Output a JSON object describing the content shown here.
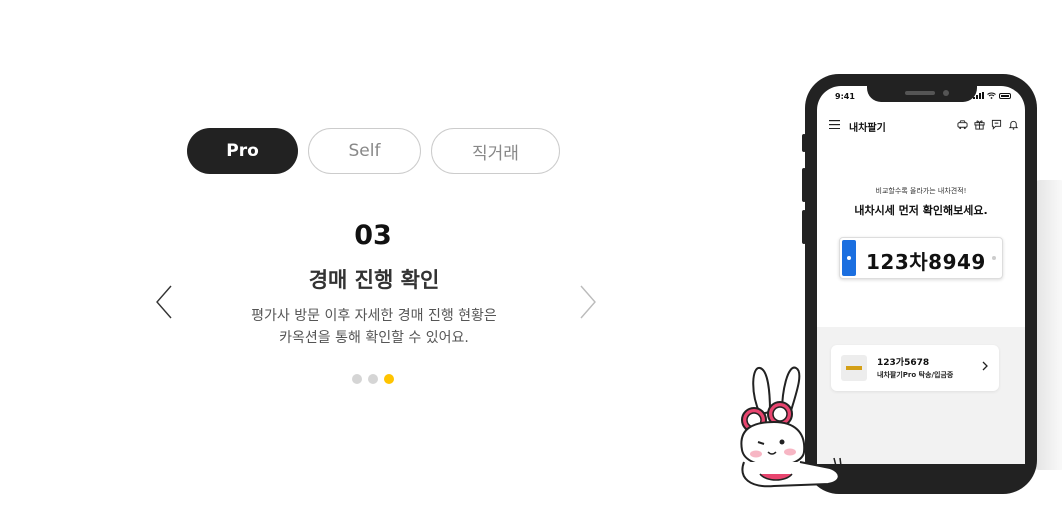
{
  "tabs": [
    {
      "label": "Pro",
      "active": true
    },
    {
      "label": "Self",
      "active": false
    },
    {
      "label": "직거래",
      "active": false
    }
  ],
  "step": {
    "number": "03",
    "title": "경매 진행 확인",
    "desc_line1": "평가사 방문 이후 자세한 경매 진행 현황은",
    "desc_line2": "카옥션을 통해 확인할 수 있어요."
  },
  "carousel": {
    "total": 3,
    "active_index": 2
  },
  "colors": {
    "accent": "#ffc400",
    "dark": "#222222",
    "plate_blue": "#1b6fe0"
  },
  "phone": {
    "status_time": "9:41",
    "app_title": "내차팔기",
    "header_icons": [
      "car-icon",
      "gift-icon",
      "chat-icon",
      "bell-icon"
    ],
    "sub_copy": "비교할수록 올라가는 내차견적!",
    "main_copy": "내차시세 먼저 확인해보세요.",
    "plate_number": "123차8949",
    "car_card": {
      "plate": "123가5678",
      "status": "내차팔기Pro 탁송/입금중"
    }
  }
}
